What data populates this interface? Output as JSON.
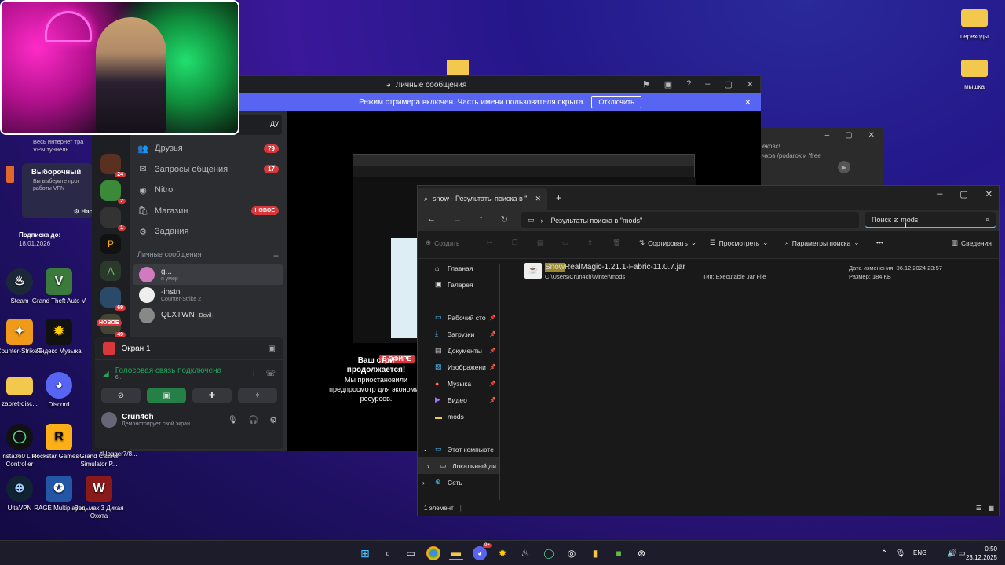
{
  "desktop": {
    "icons": [
      {
        "label": "переходы",
        "color": "#f2c94c"
      },
      {
        "label": "мышка",
        "color": "#f2c94c"
      },
      {
        "label": "Steam",
        "color": "#1b2838"
      },
      {
        "label": "Grand Theft Auto V",
        "color": "#3a7a3a"
      },
      {
        "label": "Counter-Strike 2",
        "color": "#f09a1a"
      },
      {
        "label": "Яндекс Музыка",
        "color": "#ffcc00"
      },
      {
        "label": "zapret-disc...",
        "color": "#f2c94c"
      },
      {
        "label": "Discord",
        "color": "#5865f2"
      },
      {
        "label": "Insta360 Link Controller",
        "color": "#111"
      },
      {
        "label": "Rockstar Games ...",
        "color": "#fcaf17"
      },
      {
        "label": "Grand Casino Simulator P...",
        "color": "#222"
      },
      {
        "label": "UltaVPN",
        "color": "#123"
      },
      {
        "label": "RAGE Multiplayer",
        "color": "#2456a8"
      },
      {
        "label": "Ведьмак 3 Дикая Охота",
        "color": "#8a1a1a"
      },
      {
        "label": "tl-logger7/8...",
        "color": ""
      }
    ],
    "vpn_panel": {
      "line1": "Весь интернет тра",
      "line2": "VPN туннель",
      "title": "Выборочный",
      "desc1": "Вы выберите прог",
      "desc2": "работы VPN",
      "settings": "Нас",
      "sub_label": "Подписка до:",
      "sub_date": "18.01.2026"
    }
  },
  "discord": {
    "title": "Личные сообщения",
    "banner_text": "Режим стримера включен. Часть имени пользователя скрыта.",
    "banner_button": "Отключить",
    "search_hint": "ду",
    "nav": [
      {
        "label": "Друзья",
        "icon": "👥",
        "count": "79"
      },
      {
        "label": "Запросы общения",
        "icon": "✉",
        "count": "17"
      },
      {
        "label": "Nitro",
        "icon": "◉",
        "count": ""
      },
      {
        "label": "Магазин",
        "icon": "🛍",
        "count": "",
        "badge": "НОВОЕ"
      },
      {
        "label": "Задания",
        "icon": "⚙",
        "count": ""
      }
    ],
    "dm_header": "Личные сообщения",
    "dms": [
      {
        "name": "g...",
        "sub": "я умер"
      },
      {
        "name": "-instn",
        "sub": "Counter-Strike 2"
      },
      {
        "name": "QLXTWN",
        "tag": "Devil"
      }
    ],
    "guild_badges": [
      "24",
      "2",
      "1",
      "69",
      "49"
    ],
    "guild_new": "НОВОЕ",
    "voice": {
      "screen": "Экран 1",
      "connected": "Голосовая связь подключена",
      "channel": "6...",
      "user": "Crun4ch",
      "status": "Демонстрирует свой экран"
    },
    "stream": {
      "live": "В ЭФИРЕ",
      "msg1": "Ваш стри",
      "msg2": "продолжается!",
      "msg3": "Мы приостановили",
      "msg4": "предпросмотр для экономии",
      "msg5": "ресурсов."
    }
  },
  "bgwin": {
    "line1": "ековс!",
    "line2": "чков /podarok и /free"
  },
  "explorer": {
    "tab": "snow - Результаты поиска в \"",
    "address": "Результаты поиска в \"mods\"",
    "search": "Поиск в: mods",
    "cmd": {
      "create": "Создать",
      "sort": "Сортировать",
      "view": "Просмотреть",
      "params": "Параметры поиска",
      "more": "•••",
      "details": "Сведения"
    },
    "sidebar": [
      {
        "label": "Главная",
        "icon": "⌂"
      },
      {
        "label": "Галерея",
        "icon": "▣"
      },
      {
        "label": "Рабочий сто",
        "icon": "▭",
        "pin": true
      },
      {
        "label": "Загрузки",
        "icon": "⤓",
        "pin": true
      },
      {
        "label": "Документы",
        "icon": "▤",
        "pin": true
      },
      {
        "label": "Изображени",
        "icon": "▨",
        "pin": true
      },
      {
        "label": "Музыка",
        "icon": "●",
        "pin": true
      },
      {
        "label": "Видео",
        "icon": "▶",
        "pin": true
      },
      {
        "label": "mods",
        "icon": "▬"
      },
      {
        "label": "Этот компьюте",
        "icon": "▭"
      },
      {
        "label": "Локальный ди",
        "icon": "▭"
      },
      {
        "label": "Сеть",
        "icon": "⊕"
      }
    ],
    "file": {
      "highlight": "Snow",
      "name_rest": "RealMagic-1.21.1-Fabric-11.0.7.jar",
      "path": "C:\\Users\\Crun4ch\\winter\\mods",
      "type": "Тип: Executable Jar File",
      "modified": "Дата изменения: 06.12.2024 23:57",
      "size": "Размер: 184 КБ"
    },
    "status": "1 элемент"
  },
  "taskbar": {
    "lang": "ENG",
    "time": "0:50",
    "date": "23.12.2025",
    "discord_badge": "9+"
  }
}
